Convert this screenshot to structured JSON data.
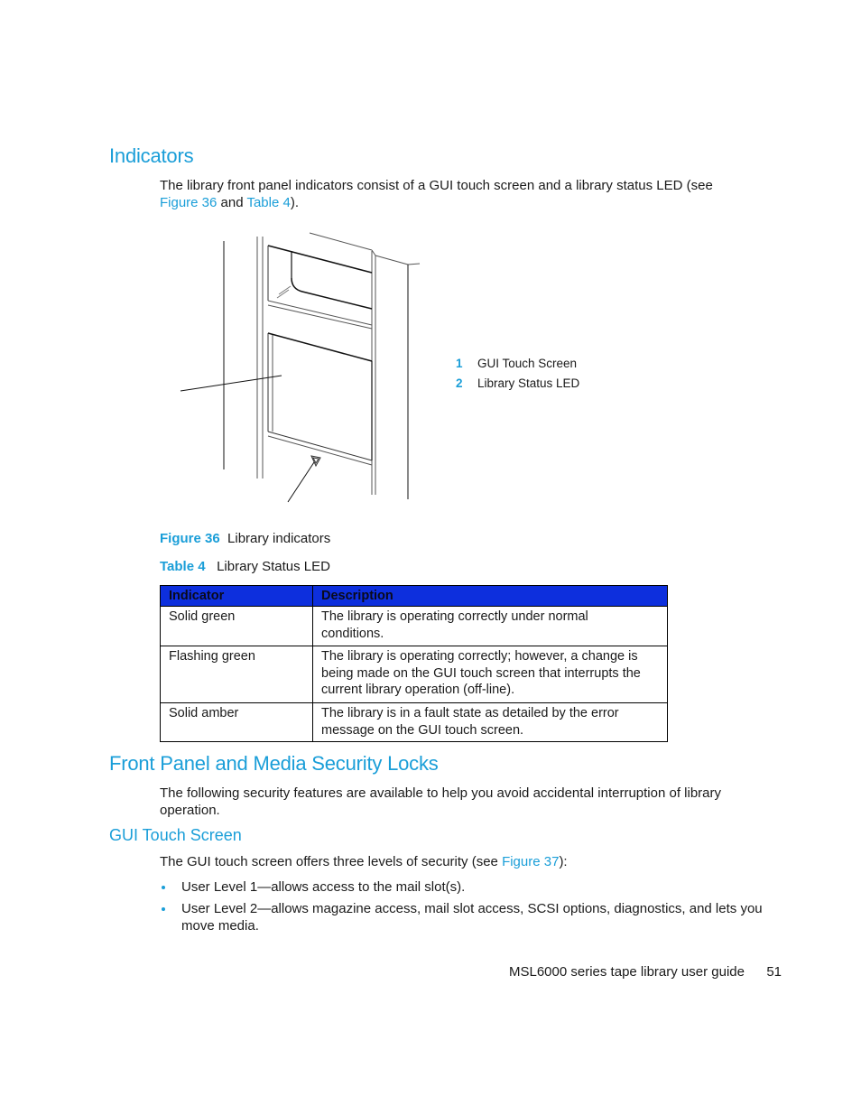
{
  "section1": {
    "heading": "Indicators",
    "intro_text_1": "The library front panel indicators consist of a GUI touch screen and a library status LED (see",
    "intro_link_1": "Figure 36",
    "intro_and": " and ",
    "intro_link_2": "Table 4",
    "intro_end": ")."
  },
  "figure": {
    "callouts": [
      {
        "number": "1",
        "label": "GUI Touch Screen"
      },
      {
        "number": "2",
        "label": "Library Status LED"
      }
    ],
    "caption_label": "Figure 36",
    "caption_text": "Library indicators"
  },
  "table": {
    "caption_label": "Table 4",
    "caption_text": "Library Status LED",
    "header_color": "#0d2fdd",
    "columns": [
      "Indicator",
      "Description"
    ],
    "rows": [
      {
        "indicator": "Solid green",
        "description": "The library is operating correctly under normal conditions."
      },
      {
        "indicator": "Flashing green",
        "description": "The library is operating correctly; however, a change is being made on the GUI touch screen that interrupts the current library operation (off-line)."
      },
      {
        "indicator": "Solid amber",
        "description": "The library is in a fault state as detailed by the error message on the GUI touch screen."
      }
    ]
  },
  "section2": {
    "heading": "Front Panel and Media Security Locks",
    "intro_text": "The following security features are available to help you avoid accidental interruption of library operation."
  },
  "section3": {
    "heading": "GUI Touch Screen",
    "intro_text": "The GUI touch screen offers three levels of security (see ",
    "intro_link": "Figure 37",
    "intro_end": "):",
    "bullets": [
      "User Level 1—allows access to the mail slot(s).",
      "User Level 2—allows magazine access, mail slot access, SCSI options, diagnostics, and lets you move media."
    ]
  },
  "footer": {
    "guide_title": "MSL6000 series tape library user guide",
    "page_number": "51"
  },
  "colors": {
    "accent": "#1a9ed8",
    "text": "#1a1a1a"
  }
}
